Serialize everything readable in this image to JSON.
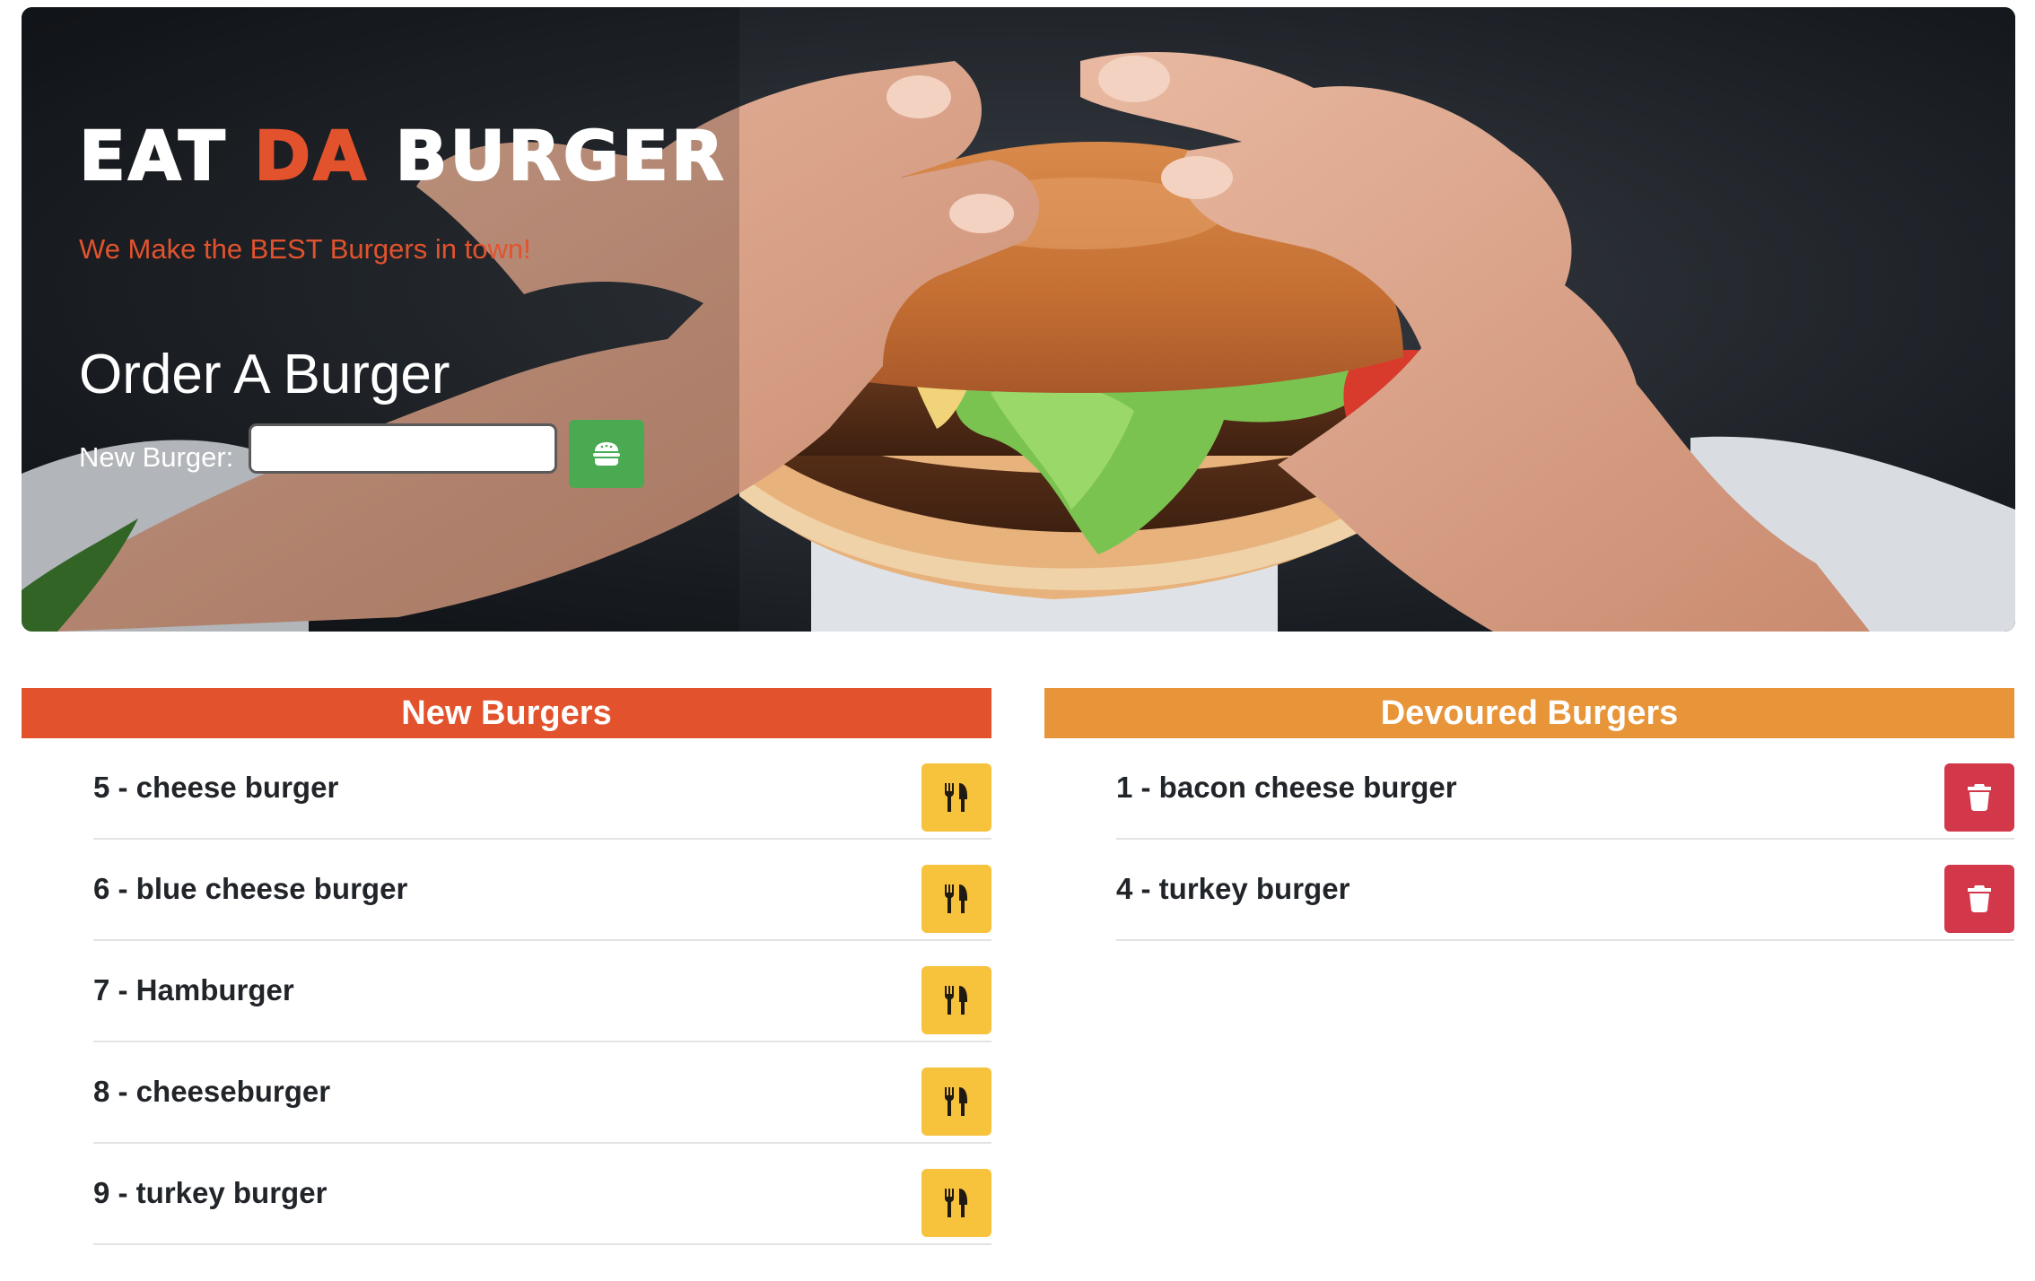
{
  "hero": {
    "title_part1": "EAT ",
    "title_accent": "DA",
    "title_part2": " BURGER",
    "tagline": "We Make the BEST Burgers in town!",
    "order_heading": "Order A Burger",
    "new_burger_label": "New Burger:",
    "new_burger_value": "",
    "add_button_icon": "hamburger-icon"
  },
  "new_burgers": {
    "header": "New Burgers",
    "action_icon": "utensils-icon",
    "items": [
      {
        "label": "5 - cheese burger"
      },
      {
        "label": "6 - blue cheese burger"
      },
      {
        "label": "7 - Hamburger"
      },
      {
        "label": "8 - cheeseburger"
      },
      {
        "label": "9 - turkey burger"
      }
    ]
  },
  "devoured_burgers": {
    "header": "Devoured Burgers",
    "action_icon": "trash-icon",
    "items": [
      {
        "label": "1 - bacon cheese burger"
      },
      {
        "label": "4 - turkey burger"
      }
    ]
  },
  "colors": {
    "brand_orange": "#e2532d",
    "devoured_orange": "#e8953a",
    "eat_yellow": "#f7c23c",
    "delete_red": "#d2384a",
    "add_green": "#4aaa52"
  }
}
